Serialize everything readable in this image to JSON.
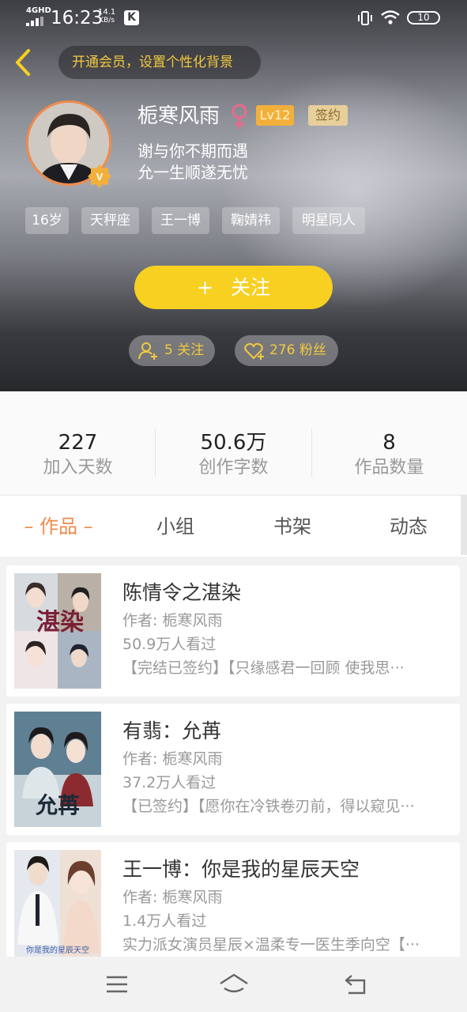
{
  "status_bar": {
    "network": "4GHD",
    "time": "16:23",
    "speed_value": "14.1",
    "speed_unit": "KB/s",
    "app_badge": "K",
    "battery": "10",
    "icons": [
      "signal-icon",
      "vibrate-icon",
      "wifi-icon",
      "battery-icon"
    ]
  },
  "header": {
    "back_icon": "back-chevron-icon",
    "vip_banner": "开通会员，设置个性化背景",
    "username": "栀寒风雨",
    "gender_icon": "female-icon",
    "level": "Lv12",
    "sign_badge": "签约",
    "bio_lines": [
      "谢与你不期而遇",
      "允一生顺遂无忧"
    ],
    "avatar_badge": "V",
    "tags": [
      "16岁",
      "天秤座",
      "王一博",
      "鞠婧祎",
      "明星同人"
    ],
    "follow_button": "关注",
    "follow_plus": "+",
    "following": "5 关注",
    "fans": "276 粉丝"
  },
  "stats": [
    {
      "value": "227",
      "label": "加入天数"
    },
    {
      "value": "50.6万",
      "label": "创作字数"
    },
    {
      "value": "8",
      "label": "作品数量"
    }
  ],
  "tabs": [
    {
      "label": "– 作品 –",
      "active": true
    },
    {
      "label": "小组",
      "active": false
    },
    {
      "label": "书架",
      "active": false
    },
    {
      "label": "动态",
      "active": false
    }
  ],
  "works": [
    {
      "title": "陈情令之湛染",
      "author": "作者: 栀寒风雨",
      "views": "50.9万人看过",
      "desc": "【完结已签约】【只缘感君一回顾  使我思···",
      "cover_text": "湛染"
    },
    {
      "title": "有翡：允苒",
      "author": "作者: 栀寒风雨",
      "views": "37.2万人看过",
      "desc": "【已签约】【愿你在冷铁卷刃前，得以窥见···",
      "cover_text": "允苒"
    },
    {
      "title": "王一博：你是我的星辰天空",
      "author": "作者: 栀寒风雨",
      "views": "1.4万人看过",
      "desc": "实力派女演员星辰×温柔专一医生季向空【···",
      "cover_text": "你是我的星辰天空"
    }
  ],
  "colors": {
    "accent": "#f08a4b",
    "follow_yellow": "#f7d021",
    "gold_text": "#f3c93f"
  },
  "nav_icons": [
    "menu-icon",
    "home-icon",
    "back-icon"
  ]
}
